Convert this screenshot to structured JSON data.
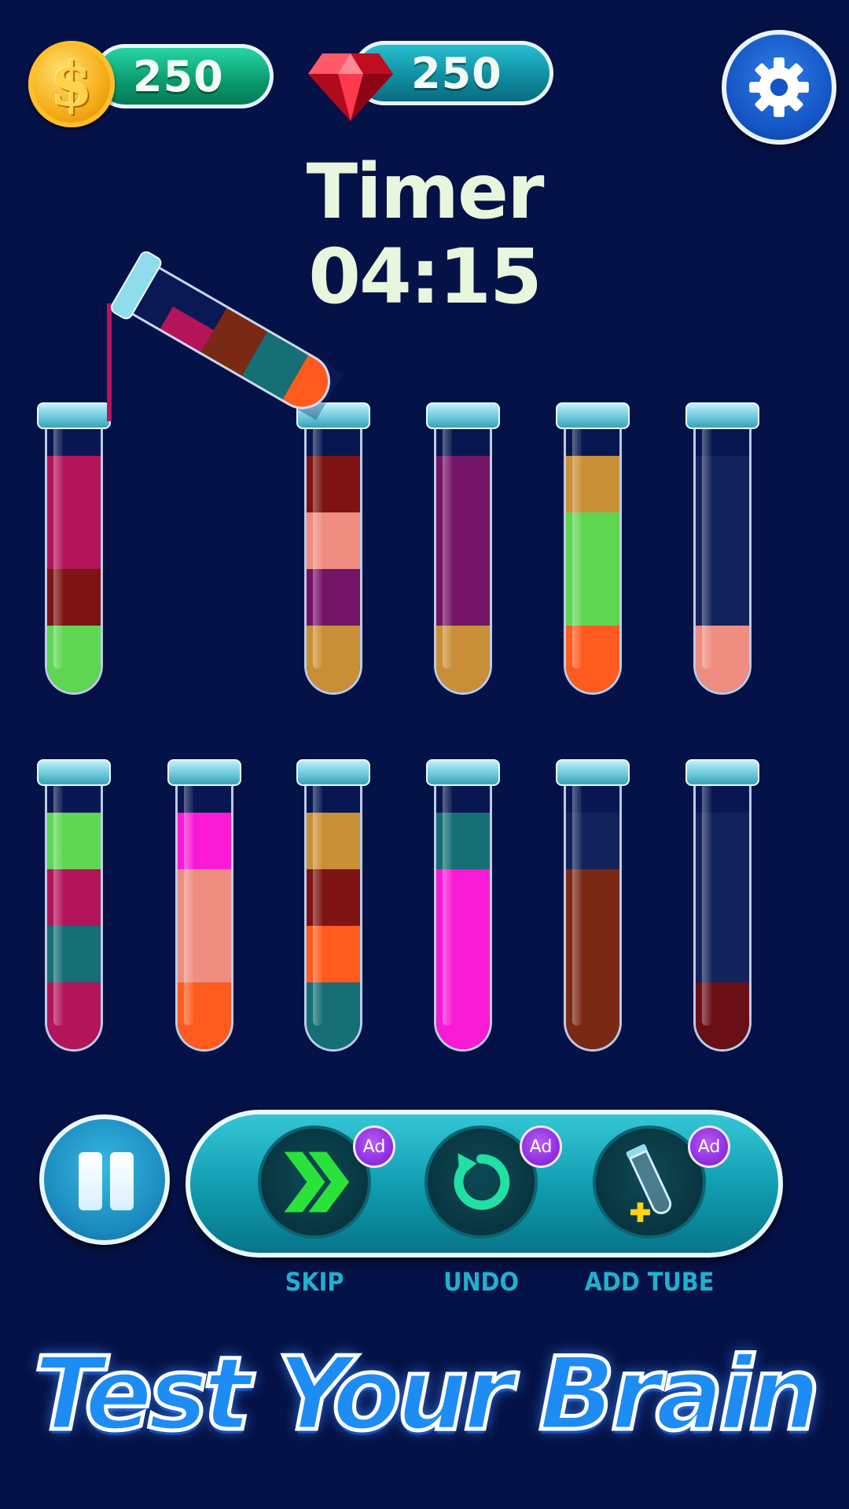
{
  "currency": {
    "coins": "250",
    "gems": "250",
    "coin_icon": "dollar-coin-icon",
    "coin_symbol": "$",
    "gem_icon": "ruby-gem-icon"
  },
  "settings": {
    "icon": "gear-icon"
  },
  "timer": {
    "label": "Timer",
    "value": "04:15"
  },
  "colors": {
    "background": "#051247",
    "crimson": "#b3145a",
    "maroon": "#7d1313",
    "lime": "#5fd652",
    "salmon": "#ef8d80",
    "purple": "#741466",
    "mustard": "#c98f36",
    "orange": "#ff5b1f",
    "navy": "#12225a",
    "magenta": "#f81ad5",
    "teal": "#156f74",
    "brown": "#7a2a14",
    "darkred": "#6b0f17"
  },
  "tubes_row1": [
    {
      "id": 1,
      "layers_top_to_bottom": [
        "crimson",
        "crimson",
        "maroon",
        "lime"
      ]
    },
    {
      "id": 2,
      "layers_top_to_bottom": [
        "maroon",
        "salmon",
        "purple",
        "mustard"
      ]
    },
    {
      "id": 3,
      "layers_top_to_bottom": [
        "purple",
        "purple",
        "purple",
        "mustard"
      ]
    },
    {
      "id": 4,
      "layers_top_to_bottom": [
        "mustard",
        "lime",
        "lime",
        "orange"
      ]
    },
    {
      "id": 5,
      "layers_top_to_bottom": [
        "navy",
        "navy",
        "navy",
        "salmon"
      ]
    }
  ],
  "tubes_row2": [
    {
      "id": 6,
      "layers_top_to_bottom": [
        "lime",
        "crimson",
        "teal",
        "crimson"
      ]
    },
    {
      "id": 7,
      "layers_top_to_bottom": [
        "magenta",
        "salmon",
        "salmon",
        "orange"
      ]
    },
    {
      "id": 8,
      "layers_top_to_bottom": [
        "mustard",
        "maroon",
        "orange",
        "teal"
      ]
    },
    {
      "id": 9,
      "layers_top_to_bottom": [
        "teal",
        "magenta",
        "magenta",
        "magenta"
      ]
    },
    {
      "id": 10,
      "layers_top_to_bottom": [
        "navy",
        "brown",
        "brown",
        "brown"
      ]
    },
    {
      "id": 11,
      "layers_top_to_bottom": [
        "navy",
        "navy",
        "navy",
        "darkred"
      ]
    }
  ],
  "pouring_tube": {
    "layers": [
      "crimson",
      "brown",
      "teal",
      "orange"
    ]
  },
  "controls": {
    "pause_icon": "pause-icon",
    "skip": {
      "label": "SKIP",
      "badge": "Ad",
      "icon": "double-chevron-right-icon"
    },
    "undo": {
      "label": "UNDO",
      "badge": "Ad",
      "icon": "undo-arrow-icon"
    },
    "add_tube": {
      "label": "ADD TUBE",
      "badge": "Ad",
      "icon": "add-tube-icon"
    }
  },
  "tagline": "Test Your Brain"
}
